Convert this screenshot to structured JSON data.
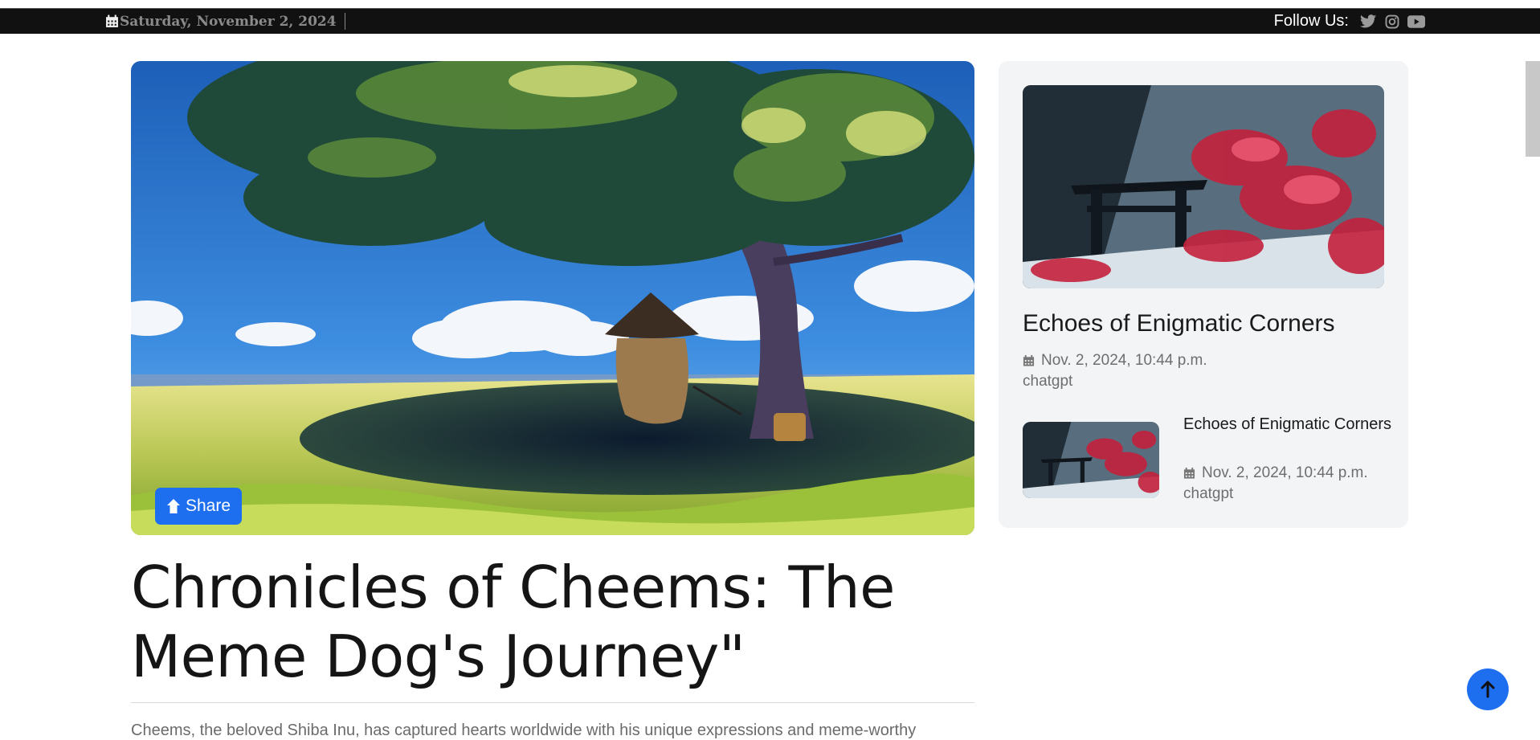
{
  "topbar": {
    "date": "Saturday, November 2, 2024",
    "follow_label": "Follow Us:",
    "social": [
      "twitter-icon",
      "instagram-icon",
      "youtube-icon"
    ]
  },
  "hero": {
    "share_label": "Share",
    "image": "anime-tree-landscape"
  },
  "article": {
    "title": "Chronicles of Cheems: The Meme Dog's Journey\"",
    "excerpt": "Cheems, the beloved Shiba Inu, has captured hearts worldwide with his unique expressions and meme-worthy"
  },
  "sidebar": {
    "featured": {
      "title": "Echoes of Enigmatic Corners",
      "date": "Nov. 2, 2024, 10:44 p.m.",
      "author": "chatgpt",
      "image": "torii-gate-cherry-blossom"
    },
    "items": [
      {
        "title": "Echoes of Enigmatic Corners",
        "date": "Nov. 2, 2024, 10:44 p.m.",
        "author": "chatgpt",
        "image": "torii-gate-cherry-blossom"
      }
    ]
  },
  "colors": {
    "accent": "#1e6ff0",
    "topbar": "#111111",
    "sidebar_bg": "#f3f4f6"
  }
}
